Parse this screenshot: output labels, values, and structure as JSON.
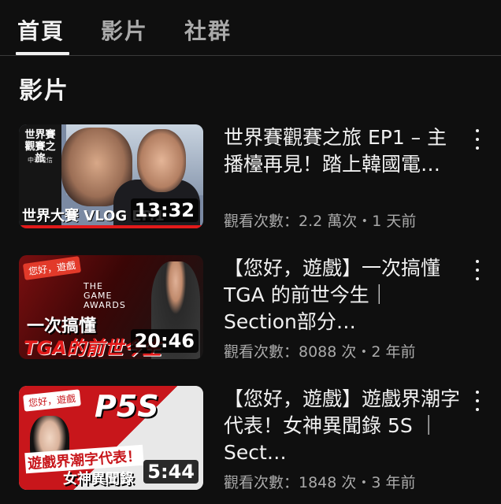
{
  "tabs": [
    {
      "label": "首頁",
      "active": true
    },
    {
      "label": "影片",
      "active": false
    },
    {
      "label": "社群",
      "active": false
    }
  ],
  "section_title": "影片",
  "videos": [
    {
      "title": "世界賽觀賽之旅 EP1 – 主播檯再見！踏上韓國電…",
      "meta": "觀看次數：2.2 萬次・1 天前",
      "duration": "13:32",
      "thumb_text": {
        "logo": "世界賽\n觀賽之旅",
        "brand": "中華電信",
        "bottom": "世界大賽 VLOG EP.1"
      }
    },
    {
      "title": "【您好，遊戲】一次搞懂 TGA 的前世今生｜ Section部分…",
      "meta": "觀看次數：8088 次・2 年前",
      "duration": "20:46",
      "thumb_text": {
        "tag": "您好，遊戲",
        "awards": "THE\nGAME\nAWARDS",
        "cap1": "一次搞懂",
        "cap2": "TGA的前世今生"
      }
    },
    {
      "title": "【您好，遊戲】遊戲界潮字代表！女神異聞錄 5S ｜ Sect…",
      "meta": "觀看次數：1848 次・3 年前",
      "duration": "5:44",
      "thumb_text": {
        "tag": "您好，遊戲",
        "logo": "P5S",
        "cap1": "遊戲界潮字代表！",
        "cap2": "女神異聞錄"
      }
    }
  ],
  "icons": {
    "more": "more-vert-icon"
  },
  "colors": {
    "background": "#0f0f0f",
    "text": "#f1f1f1",
    "secondary": "#aaaaaa",
    "accent_red": "#e21a1a"
  }
}
